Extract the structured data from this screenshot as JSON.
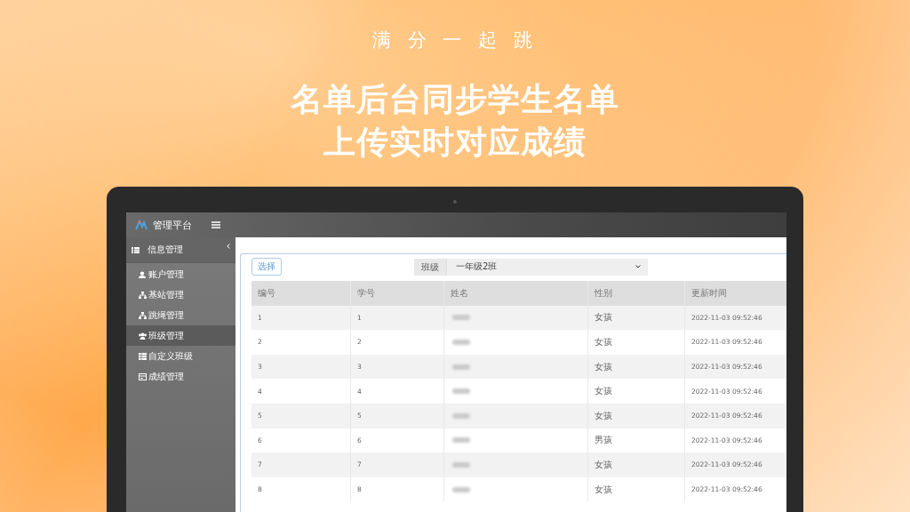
{
  "promo": {
    "tagline": "满 分 一 起 跳",
    "headline": [
      "名单后台同步学生名单",
      "上传实时对应成绩"
    ]
  },
  "app": {
    "title": "管理平台"
  },
  "sidebar": {
    "group": {
      "label": "信息管理",
      "expanded": true
    },
    "items": [
      {
        "label": "账户管理",
        "selected": false
      },
      {
        "label": "基站管理",
        "selected": false
      },
      {
        "label": "跳绳管理",
        "selected": false
      },
      {
        "label": "班级管理",
        "selected": true
      },
      {
        "label": "自定义班级",
        "selected": false
      },
      {
        "label": "成绩管理",
        "selected": false
      }
    ]
  },
  "toolbar": {
    "button": "选择",
    "filter_label": "班级",
    "filter_value": "一年级2班"
  },
  "table": {
    "columns": [
      "编号",
      "学号",
      "姓名",
      "性别",
      "更新时间"
    ],
    "rows": [
      {
        "no": "1",
        "student_id": "1",
        "name_blurred": true,
        "gender": "女孩",
        "updated": "2022-11-03 09:52:46"
      },
      {
        "no": "2",
        "student_id": "2",
        "name_blurred": true,
        "gender": "女孩",
        "updated": "2022-11-03 09:52:46"
      },
      {
        "no": "3",
        "student_id": "3",
        "name_blurred": true,
        "gender": "女孩",
        "updated": "2022-11-03 09:52:46"
      },
      {
        "no": "4",
        "student_id": "4",
        "name_blurred": true,
        "gender": "女孩",
        "updated": "2022-11-03 09:52:46"
      },
      {
        "no": "5",
        "student_id": "5",
        "name_blurred": true,
        "gender": "女孩",
        "updated": "2022-11-03 09:52:46"
      },
      {
        "no": "6",
        "student_id": "6",
        "name_blurred": true,
        "gender": "男孩",
        "updated": "2022-11-03 09:52:46"
      },
      {
        "no": "7",
        "student_id": "7",
        "name_blurred": true,
        "gender": "女孩",
        "updated": "2022-11-03 09:52:46"
      },
      {
        "no": "8",
        "student_id": "8",
        "name_blurred": true,
        "gender": "女孩",
        "updated": "2022-11-03 09:52:46"
      }
    ]
  }
}
